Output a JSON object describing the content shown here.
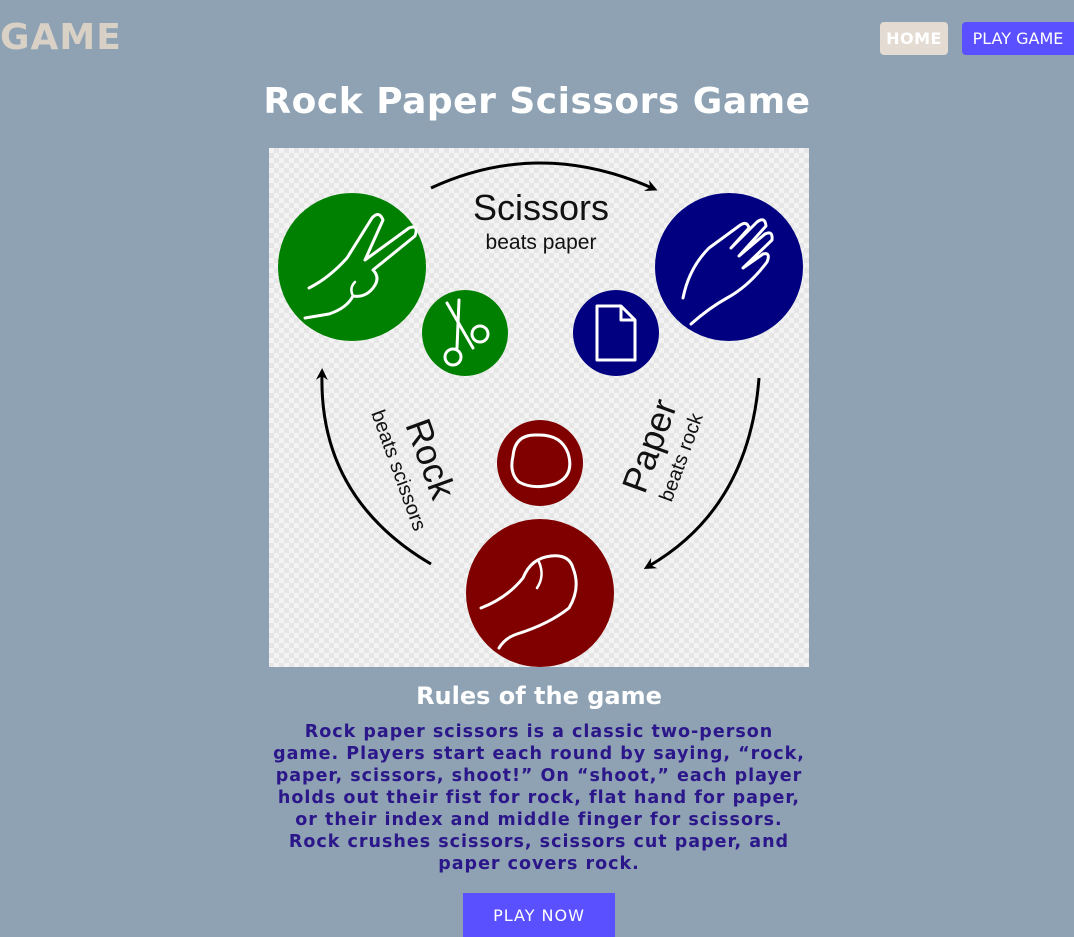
{
  "header": {
    "logo": "GAME",
    "nav": {
      "home_label": "HOME",
      "play_game_label": "PLAY GAME"
    }
  },
  "main": {
    "title": "Rock Paper Scissors Game",
    "illustration": {
      "scissors_label": "Scissors",
      "scissors_sub": "beats paper",
      "rock_label": "Rock",
      "rock_sub": "beats scissors",
      "paper_label": "Paper",
      "paper_sub": "beats rock",
      "icons": [
        "scissors-hand-icon",
        "scissors-icon",
        "paper-hand-icon",
        "paper-icon",
        "rock-icon",
        "rock-fist-icon"
      ],
      "colors": {
        "scissors": "#008000",
        "paper": "#000080",
        "rock": "#800000"
      }
    },
    "rules": {
      "heading": "Rules of the game",
      "body": "Rock paper scissors is a classic two-person game. Players start each round by saying, “rock, paper, scissors, shoot!” On “shoot,” each player holds out their fist for rock, flat hand for paper, or their index and middle finger for scissors. Rock crushes scissors, scissors cut paper, and paper covers rock."
    },
    "cta_label": "PLAY NOW"
  },
  "colors": {
    "background": "#8ea2b3",
    "accent": "#5a50ff",
    "rules_text": "#2b168a"
  }
}
